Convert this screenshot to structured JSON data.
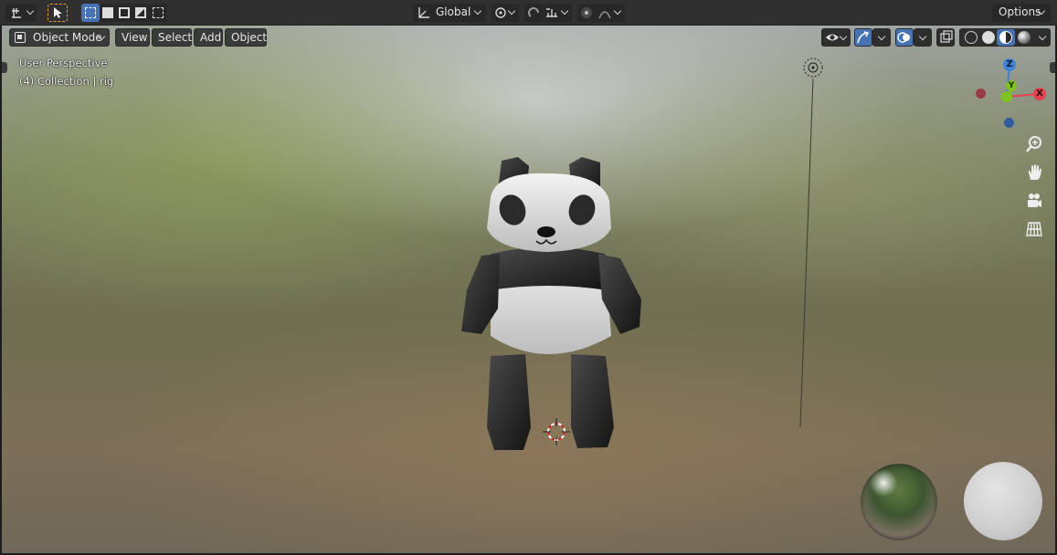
{
  "header": {
    "transform_orientation": "Global",
    "options_label": "Options"
  },
  "viewport_header": {
    "mode_label": "Object Mode",
    "menus": [
      {
        "label": "View"
      },
      {
        "label": "Select"
      },
      {
        "label": "Add"
      },
      {
        "label": "Object"
      }
    ]
  },
  "viewport": {
    "view_name": "User Perspective",
    "collection_info": "(4) Collection | rig"
  },
  "navigation_gizmo": {
    "x_label": "X",
    "y_label": "Y",
    "z_label": "Z",
    "colors": {
      "x": "#e5404f",
      "y": "#7ec220",
      "z": "#3e82d6"
    }
  },
  "navigation_icons": [
    "zoom-icon",
    "hand-pan-icon",
    "camera-icon",
    "grid-perspective-icon"
  ],
  "lookdev": {
    "hdri_preview": "forest-hdri-sphere",
    "material_preview": "white-matte-sphere"
  },
  "theme": {
    "accent": "#4772b3",
    "header_bg": "#303030",
    "button_bg": "#3a3a3a"
  }
}
